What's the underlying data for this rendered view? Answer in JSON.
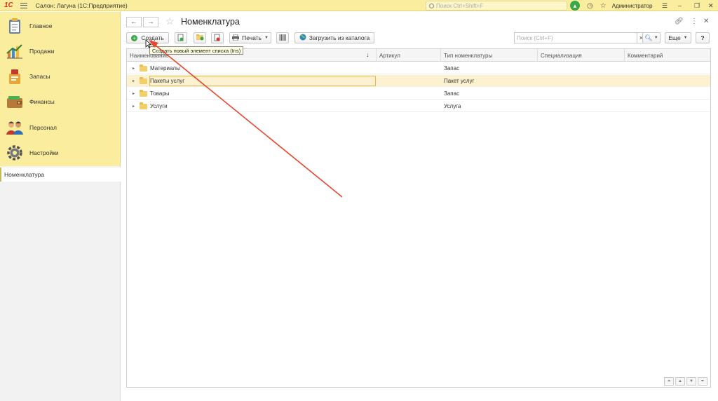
{
  "titlebar": {
    "logo": "1С",
    "title": "Салон: Лагуна  (1С:Предприятие)",
    "search_placeholder": "Поиск Ctrl+Shift+F",
    "user": "Администратор"
  },
  "sidebar": {
    "items": [
      {
        "label": "Главное",
        "icon": "clipboard-icon"
      },
      {
        "label": "Продажи",
        "icon": "chart-icon"
      },
      {
        "label": "Запасы",
        "icon": "stock-icon"
      },
      {
        "label": "Финансы",
        "icon": "wallet-icon"
      },
      {
        "label": "Персонал",
        "icon": "people-icon"
      },
      {
        "label": "Настройки",
        "icon": "gear-icon"
      }
    ],
    "open_window": "Номенклатура"
  },
  "form": {
    "title": "Номенклатура",
    "create_label": "Создать",
    "print_label": "Печать",
    "load_label": "Загрузить из каталога",
    "search_placeholder": "Поиск (Ctrl+F)",
    "more_label": "Еще",
    "help_label": "?",
    "tooltip": "Создать новый элемент списка (Ins)"
  },
  "table": {
    "columns": [
      "Наименование",
      "Артикул",
      "Тип номенклатуры",
      "Специализация",
      "Комментарий"
    ],
    "rows": [
      {
        "name": "Материалы",
        "article": "",
        "type": "Запас",
        "spec": "",
        "comment": ""
      },
      {
        "name": "Пакеты услуг",
        "article": "",
        "type": "Пакет услуг",
        "spec": "",
        "comment": ""
      },
      {
        "name": "Товары",
        "article": "",
        "type": "Запас",
        "spec": "",
        "comment": ""
      },
      {
        "name": "Услуги",
        "article": "",
        "type": "Услуга",
        "spec": "",
        "comment": ""
      }
    ],
    "selected_row": 1
  },
  "colors": {
    "panel_yellow": "#fbed9e",
    "selection": "#fcf2cf",
    "annotation_arrow": "#e8462e",
    "green": "#3aa84a"
  }
}
